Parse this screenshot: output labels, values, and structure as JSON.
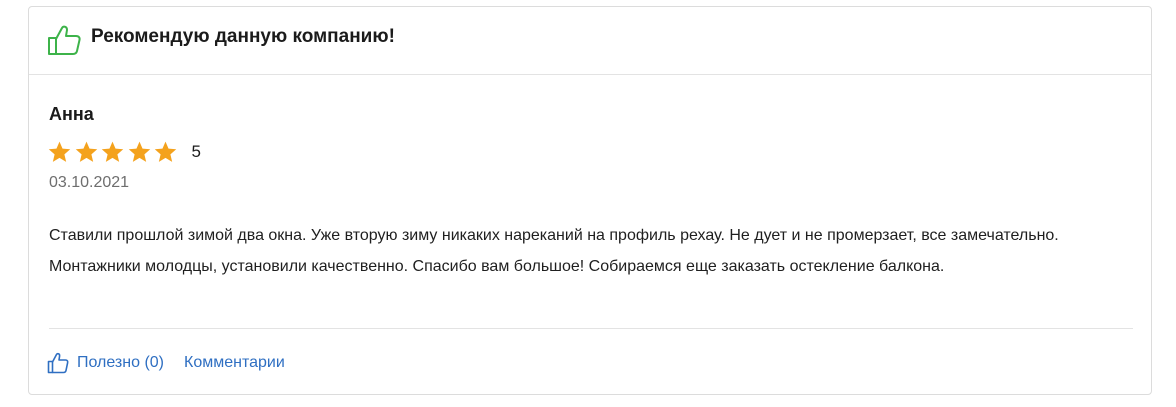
{
  "header": {
    "title": "Рекомендую данную компанию!",
    "icon": "thumbs-up-icon",
    "icon_color": "#3db34a"
  },
  "review": {
    "author": "Анна",
    "rating": 5,
    "rating_max": 5,
    "rating_label": "5",
    "star_color": "#f4a21d",
    "date": "03.10.2021",
    "text": "Ставили прошлой зимой два окна. Уже вторую зиму никаких нареканий на профиль рехау. Не дует и не промерзает, все замечательно. Монтажники молодцы, установили качественно. Спасибо вам большое! Собираемся еще заказать остекление балкона."
  },
  "footer": {
    "useful_label": "Полезно (0)",
    "comments_label": "Комментарии",
    "link_color": "#2f6fc2"
  }
}
